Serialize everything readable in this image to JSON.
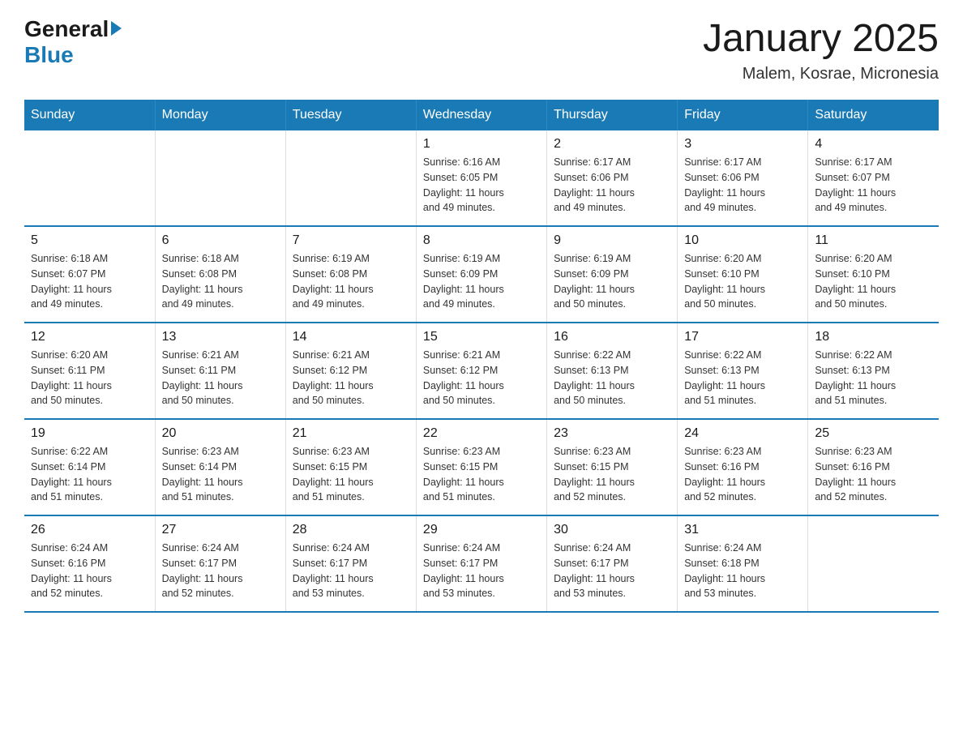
{
  "logo": {
    "general": "General",
    "blue": "Blue"
  },
  "title": "January 2025",
  "subtitle": "Malem, Kosrae, Micronesia",
  "headers": [
    "Sunday",
    "Monday",
    "Tuesday",
    "Wednesday",
    "Thursday",
    "Friday",
    "Saturday"
  ],
  "weeks": [
    [
      {
        "day": "",
        "info": ""
      },
      {
        "day": "",
        "info": ""
      },
      {
        "day": "",
        "info": ""
      },
      {
        "day": "1",
        "info": "Sunrise: 6:16 AM\nSunset: 6:05 PM\nDaylight: 11 hours\nand 49 minutes."
      },
      {
        "day": "2",
        "info": "Sunrise: 6:17 AM\nSunset: 6:06 PM\nDaylight: 11 hours\nand 49 minutes."
      },
      {
        "day": "3",
        "info": "Sunrise: 6:17 AM\nSunset: 6:06 PM\nDaylight: 11 hours\nand 49 minutes."
      },
      {
        "day": "4",
        "info": "Sunrise: 6:17 AM\nSunset: 6:07 PM\nDaylight: 11 hours\nand 49 minutes."
      }
    ],
    [
      {
        "day": "5",
        "info": "Sunrise: 6:18 AM\nSunset: 6:07 PM\nDaylight: 11 hours\nand 49 minutes."
      },
      {
        "day": "6",
        "info": "Sunrise: 6:18 AM\nSunset: 6:08 PM\nDaylight: 11 hours\nand 49 minutes."
      },
      {
        "day": "7",
        "info": "Sunrise: 6:19 AM\nSunset: 6:08 PM\nDaylight: 11 hours\nand 49 minutes."
      },
      {
        "day": "8",
        "info": "Sunrise: 6:19 AM\nSunset: 6:09 PM\nDaylight: 11 hours\nand 49 minutes."
      },
      {
        "day": "9",
        "info": "Sunrise: 6:19 AM\nSunset: 6:09 PM\nDaylight: 11 hours\nand 50 minutes."
      },
      {
        "day": "10",
        "info": "Sunrise: 6:20 AM\nSunset: 6:10 PM\nDaylight: 11 hours\nand 50 minutes."
      },
      {
        "day": "11",
        "info": "Sunrise: 6:20 AM\nSunset: 6:10 PM\nDaylight: 11 hours\nand 50 minutes."
      }
    ],
    [
      {
        "day": "12",
        "info": "Sunrise: 6:20 AM\nSunset: 6:11 PM\nDaylight: 11 hours\nand 50 minutes."
      },
      {
        "day": "13",
        "info": "Sunrise: 6:21 AM\nSunset: 6:11 PM\nDaylight: 11 hours\nand 50 minutes."
      },
      {
        "day": "14",
        "info": "Sunrise: 6:21 AM\nSunset: 6:12 PM\nDaylight: 11 hours\nand 50 minutes."
      },
      {
        "day": "15",
        "info": "Sunrise: 6:21 AM\nSunset: 6:12 PM\nDaylight: 11 hours\nand 50 minutes."
      },
      {
        "day": "16",
        "info": "Sunrise: 6:22 AM\nSunset: 6:13 PM\nDaylight: 11 hours\nand 50 minutes."
      },
      {
        "day": "17",
        "info": "Sunrise: 6:22 AM\nSunset: 6:13 PM\nDaylight: 11 hours\nand 51 minutes."
      },
      {
        "day": "18",
        "info": "Sunrise: 6:22 AM\nSunset: 6:13 PM\nDaylight: 11 hours\nand 51 minutes."
      }
    ],
    [
      {
        "day": "19",
        "info": "Sunrise: 6:22 AM\nSunset: 6:14 PM\nDaylight: 11 hours\nand 51 minutes."
      },
      {
        "day": "20",
        "info": "Sunrise: 6:23 AM\nSunset: 6:14 PM\nDaylight: 11 hours\nand 51 minutes."
      },
      {
        "day": "21",
        "info": "Sunrise: 6:23 AM\nSunset: 6:15 PM\nDaylight: 11 hours\nand 51 minutes."
      },
      {
        "day": "22",
        "info": "Sunrise: 6:23 AM\nSunset: 6:15 PM\nDaylight: 11 hours\nand 51 minutes."
      },
      {
        "day": "23",
        "info": "Sunrise: 6:23 AM\nSunset: 6:15 PM\nDaylight: 11 hours\nand 52 minutes."
      },
      {
        "day": "24",
        "info": "Sunrise: 6:23 AM\nSunset: 6:16 PM\nDaylight: 11 hours\nand 52 minutes."
      },
      {
        "day": "25",
        "info": "Sunrise: 6:23 AM\nSunset: 6:16 PM\nDaylight: 11 hours\nand 52 minutes."
      }
    ],
    [
      {
        "day": "26",
        "info": "Sunrise: 6:24 AM\nSunset: 6:16 PM\nDaylight: 11 hours\nand 52 minutes."
      },
      {
        "day": "27",
        "info": "Sunrise: 6:24 AM\nSunset: 6:17 PM\nDaylight: 11 hours\nand 52 minutes."
      },
      {
        "day": "28",
        "info": "Sunrise: 6:24 AM\nSunset: 6:17 PM\nDaylight: 11 hours\nand 53 minutes."
      },
      {
        "day": "29",
        "info": "Sunrise: 6:24 AM\nSunset: 6:17 PM\nDaylight: 11 hours\nand 53 minutes."
      },
      {
        "day": "30",
        "info": "Sunrise: 6:24 AM\nSunset: 6:17 PM\nDaylight: 11 hours\nand 53 minutes."
      },
      {
        "day": "31",
        "info": "Sunrise: 6:24 AM\nSunset: 6:18 PM\nDaylight: 11 hours\nand 53 minutes."
      },
      {
        "day": "",
        "info": ""
      }
    ]
  ]
}
